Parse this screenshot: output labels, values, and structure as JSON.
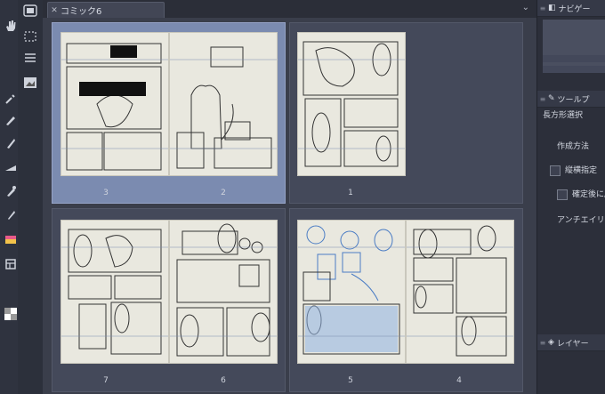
{
  "tab": {
    "title": "コミック6",
    "close_icon": "close-icon"
  },
  "pages": {
    "group1": [
      "3",
      "2"
    ],
    "group2": [
      "1"
    ],
    "group3": [
      "7",
      "6"
    ],
    "group4": [
      "5",
      "4"
    ]
  },
  "right_panel": {
    "navigator_title": "ナビゲー",
    "tool_title": "ツールプ",
    "tool_name": "長方形選択",
    "creation_method": "作成方法",
    "aspect_label": "縦横指定",
    "confirm_label": "確定後に局",
    "antialias_label": "アンチエイリア",
    "layer_title": "レイヤー"
  },
  "colors": {
    "selected_group": "#7b8bb0",
    "page_paper": "#e9e8df",
    "accent_yellow": "#f5c62e"
  }
}
